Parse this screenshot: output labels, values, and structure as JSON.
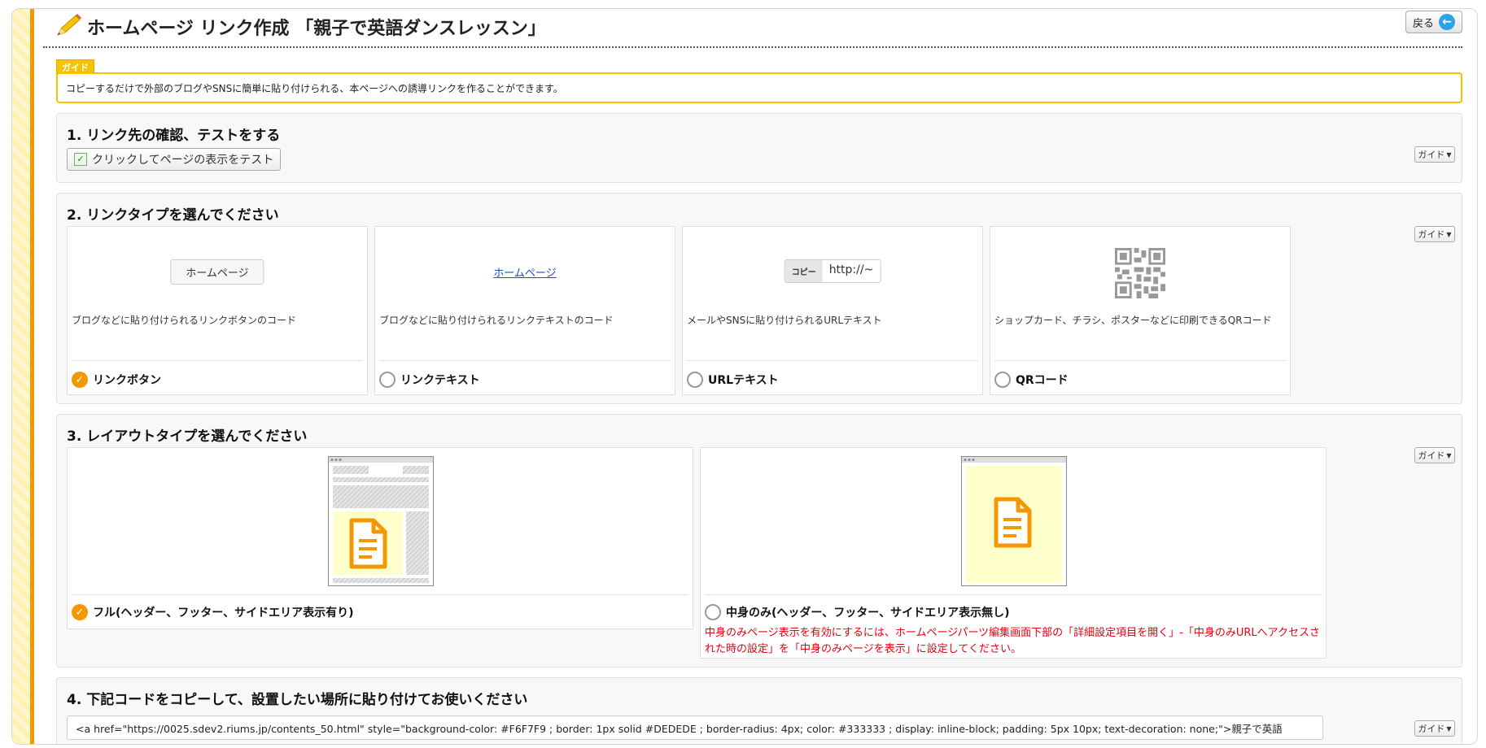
{
  "header": {
    "title": "ホームページ リンク作成 「親子で英語ダンスレッスン」",
    "back_label": "戻る"
  },
  "guide": {
    "tag": "ガイド",
    "text": "コピーするだけで外部のブログやSNSに簡単に貼り付けられる、本ページへの誘導リンクを作ることができます。"
  },
  "guide_button_label": "ガイド",
  "section1": {
    "title": "1. リンク先の確認、テストをする",
    "test_button": "クリックしてページの表示をテスト"
  },
  "section2": {
    "title": "2. リンクタイプを選んでください",
    "cards": [
      {
        "demo": "ホームページ",
        "desc": "ブログなどに貼り付けられるリンクボタンのコード",
        "label": "リンクボタン",
        "selected": true
      },
      {
        "demo": "ホームページ",
        "desc": "ブログなどに貼り付けられるリンクテキストのコード",
        "label": "リンクテキスト",
        "selected": false
      },
      {
        "demo_copy": "コピー",
        "demo": "http://~",
        "desc": "メールやSNSに貼り付けられるURLテキスト",
        "label": "URLテキスト",
        "selected": false
      },
      {
        "desc": "ショップカード、チラシ、ポスターなどに印刷できるQRコード",
        "label": "QRコード",
        "selected": false
      }
    ]
  },
  "section3": {
    "title": "3. レイアウトタイプを選んでください",
    "options": [
      {
        "label": "フル(ヘッダー、フッター、サイドエリア表示有り)",
        "selected": true
      },
      {
        "label": "中身のみ(ヘッダー、フッター、サイドエリア表示無し)",
        "selected": false
      }
    ],
    "note": "中身のみページ表示を有効にするには、ホームページパーツ編集画面下部の「詳細設定項目を開く」-「中身のみURLへアクセスされた時の設定」を「中身のみページを表示」に設定してください。"
  },
  "section4": {
    "title": "4. 下記コードをコピーして、設置したい場所に貼り付けてお使いください",
    "code": "<a href=\"https://0025.sdev2.riums.jp/contents_50.html\" style=\"background-color: #F6F7F9 ; border: 1px solid #DEDEDE ; border-radius: 4px; color: #333333 ; display: inline-block; padding: 5px 10px; text-decoration: none;\">親子で英語"
  },
  "colors": {
    "accent": "#f39800",
    "guide_yellow": "#f5c400",
    "warning_red": "#e60012",
    "link_blue": "#1a4fb3"
  }
}
